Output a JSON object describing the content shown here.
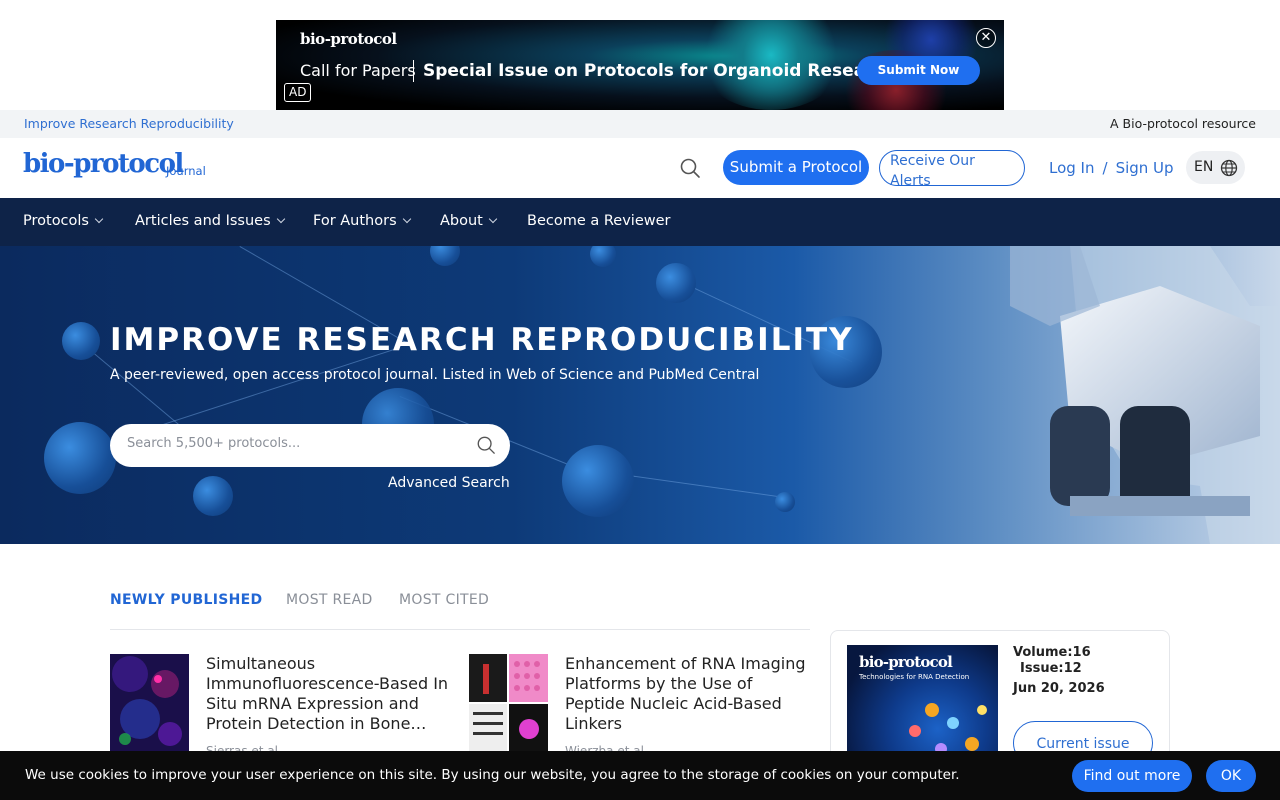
{
  "ad": {
    "logo": "bio-protocol",
    "call": "Call for Papers",
    "title": "Special Issue on Protocols for Organoid Research",
    "button": "Submit Now",
    "tag": "AD",
    "close_icon": "close-icon"
  },
  "util_bar": {
    "left": "Improve Research Reproducibility",
    "right": "A Bio-protocol resource"
  },
  "header": {
    "logo": "bio-protocol",
    "logo_sub": "Journal",
    "submit": "Submit a Protocol",
    "alerts": "Receive Our Alerts",
    "login": "Log In",
    "login_sep": "/",
    "signup": "Sign Up",
    "lang": "EN",
    "search_icon": "search-icon",
    "globe_icon": "globe-icon"
  },
  "nav": [
    {
      "label": "Protocols"
    },
    {
      "label": "Articles and Issues"
    },
    {
      "label": "For Authors"
    },
    {
      "label": "About"
    },
    {
      "label": "Become a Reviewer"
    }
  ],
  "hero": {
    "title": "IMPROVE RESEARCH REPRODUCIBILITY",
    "subtitle": "A peer-reviewed, open access protocol journal. Listed in Web of Science and PubMed Central",
    "search_placeholder": "Search 5,500+ protocols...",
    "advanced": "Advanced Search"
  },
  "tabs": [
    {
      "label": "NEWLY PUBLISHED",
      "active": true
    },
    {
      "label": "MOST READ",
      "active": false
    },
    {
      "label": "MOST CITED",
      "active": false
    }
  ],
  "articles": [
    {
      "title": "Simultaneous Immunofluorescence-Based In Situ mRNA Expression and Protein Detection in Bone…",
      "author": "Sierras et al."
    },
    {
      "title": "Enhancement of RNA Imaging Platforms by the Use of Peptide Nucleic Acid-Based Linkers",
      "author": "Wierzba et al."
    }
  ],
  "issue": {
    "cover_title": "bio-protocol",
    "cover_sub": "Technologies for RNA Detection",
    "volume": "Volume:16",
    "issue": "Issue:12",
    "date": "Jun 20, 2026",
    "button": "Current issue"
  },
  "cookie": {
    "text": "We use cookies to improve your user experience on this site. By using our website, you agree to the storage of cookies on your computer.",
    "find_out": "Find out more",
    "ok": "OK"
  },
  "colors": {
    "brand": "#2166d4",
    "nav_bg": "#0e2348",
    "button": "#1f6ff0"
  }
}
